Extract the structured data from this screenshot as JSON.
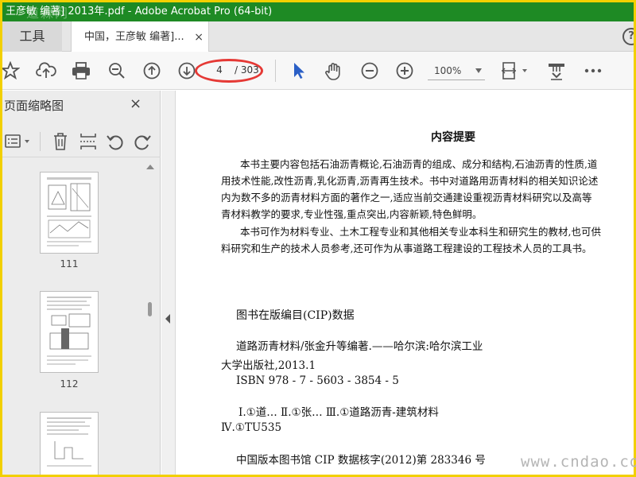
{
  "titlebar": {
    "title": "王彦敏 编著] 2013年.pdf - Adobe Acrobat Pro (64-bit)",
    "watermark": "道森网"
  },
  "tabs": {
    "tools_label": "工具",
    "doc_label": "中国，王彦敏 编著]...",
    "close_glyph": "×",
    "help_glyph": "?"
  },
  "toolbar": {
    "page_current": "4",
    "page_total": "/ 303",
    "zoom": "100%",
    "icons": [
      "star-icon",
      "upload-icon",
      "print-icon",
      "zoom-out-search-icon",
      "page-up-icon",
      "page-down-icon",
      "select-arrow-icon",
      "hand-icon",
      "zoom-out-icon",
      "zoom-in-icon",
      "fit-page-icon",
      "stamp-icon",
      "more-icon"
    ]
  },
  "sidebar": {
    "title": "页面缩略图",
    "close_glyph": "×",
    "thumbs": [
      {
        "label": "111"
      },
      {
        "label": "112"
      },
      {
        "label": ""
      }
    ]
  },
  "document": {
    "heading": "内容提要",
    "paragraphs": [
      "本书主要内容包括石油沥青概论,石油沥青的组成、成分和结构,石油沥青的性质,道",
      "用技术性能,改性沥青,乳化沥青,沥青再生技术。书中对道路用沥青材料的相关知识论述",
      "内为数不多的沥青材料方面的著作之一,适应当前交通建设重视沥青材料研究以及高等",
      "青材料教学的要求,专业性强,重点突出,内容新颖,特色鲜明。",
      "本书可作为材料专业、土木工程专业和其他相关专业本科生和研究生的教材,也可供",
      "料研究和生产的技术人员参考,还可作为从事道路工程建设的工程技术人员的工具书。"
    ],
    "cip_heading": "图书在版编目(CIP)数据",
    "cip_lines": [
      "道路沥青材料/张金升等编著.——哈尔滨:哈尔滨工业",
      "大学出版社,2013.1",
      "ISBN 978 - 7 - 5603 - 3854 - 5",
      "Ⅰ.①道…   Ⅱ.①张…   Ⅲ.①道路沥青-建筑材料",
      "Ⅳ.①TU535",
      "中国版本图书馆 CIP 数据核字(2012)第 283346 号"
    ],
    "watermark": "www.cndao.com"
  }
}
